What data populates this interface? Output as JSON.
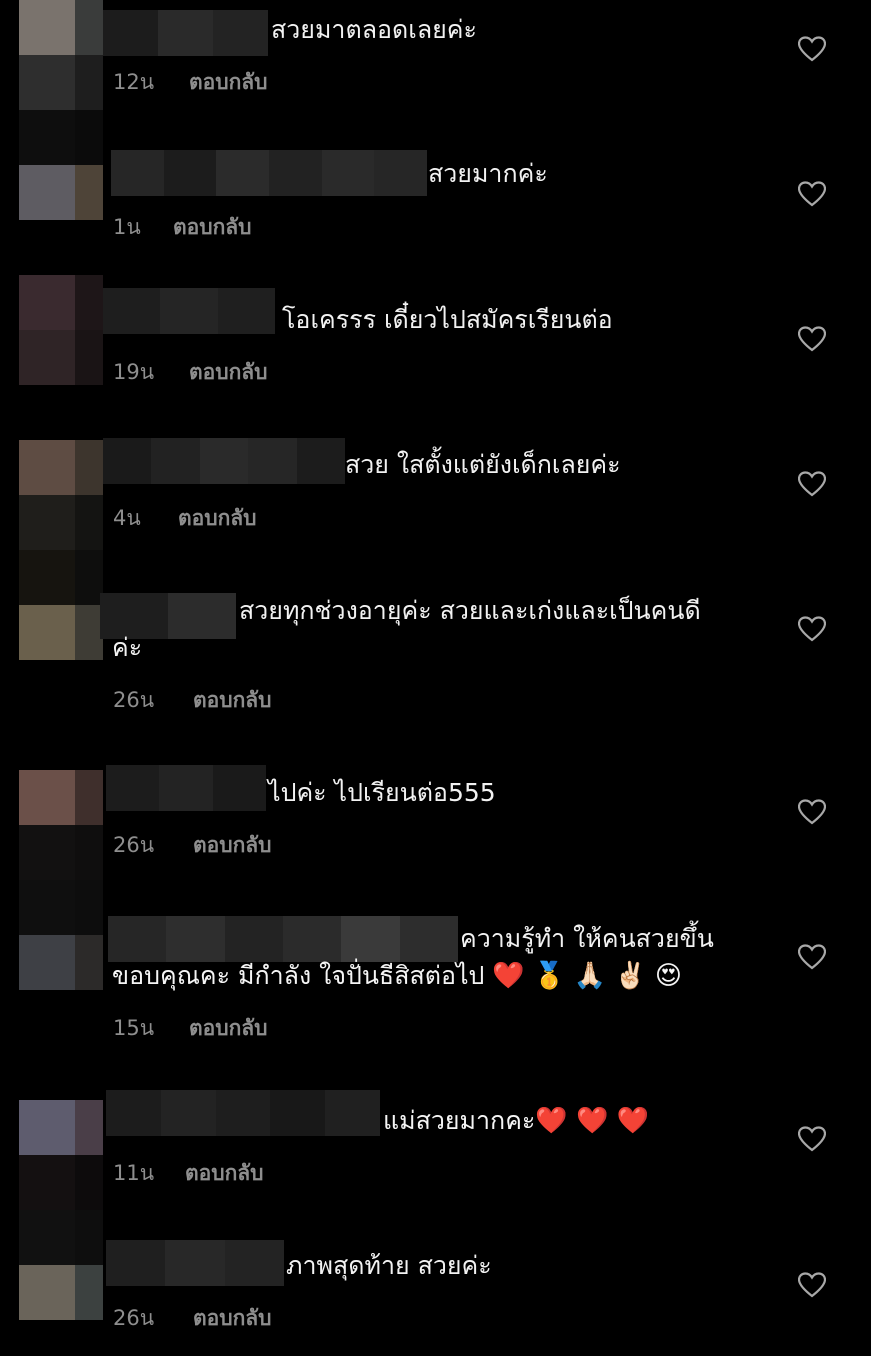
{
  "colors": {
    "background": "#000000",
    "text": "#f2f2f2",
    "meta": "#8e8e8e"
  },
  "comments": [
    {
      "text": "สวยมาตลอดเลยค่ะ",
      "time": "12น",
      "reply": "ตอบกลับ"
    },
    {
      "text": "สวยมากค่ะ",
      "time": "1น",
      "reply": "ตอบกลับ"
    },
    {
      "text": "โอเครรร เดี๋ยวไปสมัครเรียนต่อ",
      "time": "19น",
      "reply": "ตอบกลับ"
    },
    {
      "text": "สวย ใสตั้งแต่ยังเด็กเลยค่ะ",
      "time": "4น",
      "reply": "ตอบกลับ"
    },
    {
      "text_line1": "สวยทุกช่วงอายุค่ะ สวยและเก่งและเป็นคนดี",
      "text_line2": "ค่ะ",
      "time": "26น",
      "reply": "ตอบกลับ"
    },
    {
      "text": "ไปค่ะ ไปเรียนต่อ555",
      "time": "26น",
      "reply": "ตอบกลับ"
    },
    {
      "text_line1": "ความรู้ทำ ให้คนสวยขึ้น",
      "text_line2": "ขอบคุณคะ มีกำลัง ใจปั่นธีสิสต่อไป",
      "emojis": "❤️ 🥇 🙏🏻 ✌🏻 😍",
      "time": "15น",
      "reply": "ตอบกลับ"
    },
    {
      "text": "แม่สวยมากคะ",
      "emojis": "❤️ ❤️ ❤️",
      "time": "11น",
      "reply": "ตอบกลับ"
    },
    {
      "text": "ภาพสุดท้าย สวยค่ะ",
      "time": "26น",
      "reply": "ตอบกลับ"
    }
  ],
  "icons": {
    "like": "heart-outline-icon"
  }
}
